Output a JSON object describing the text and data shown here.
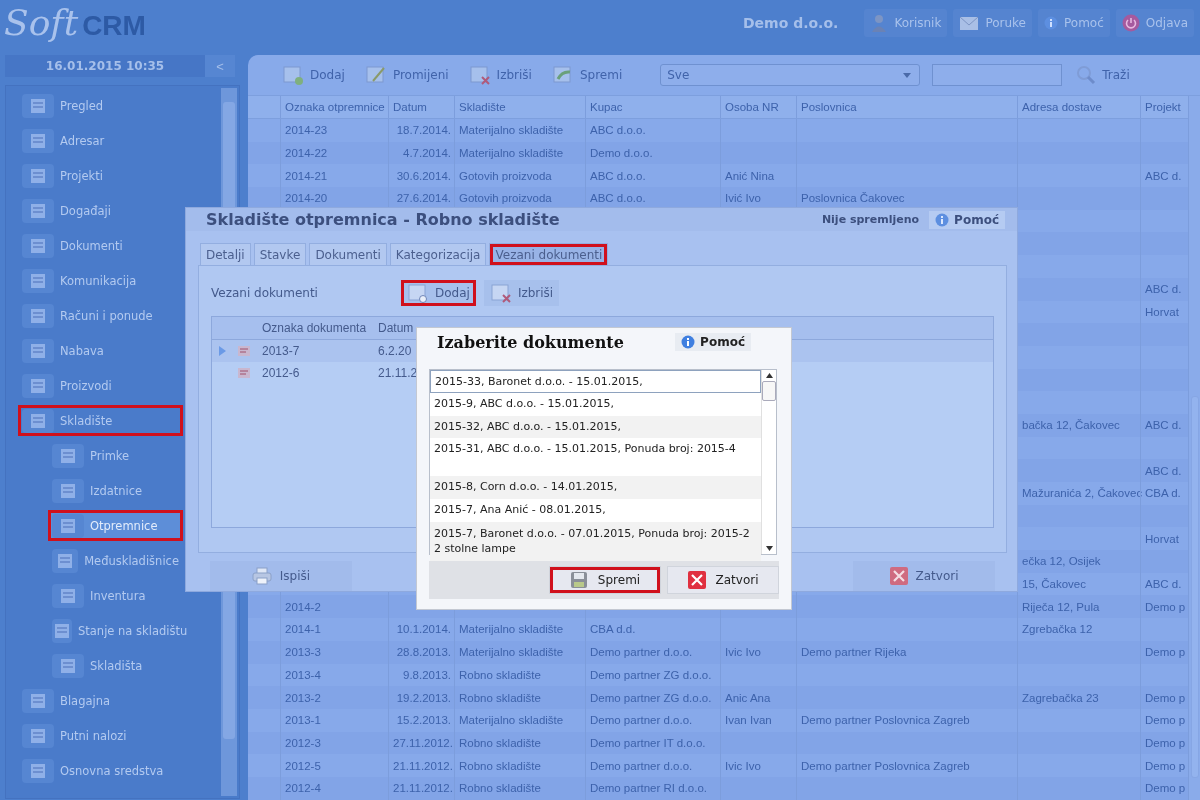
{
  "header": {
    "logo_light": "Soft",
    "logo_bold": "CRM",
    "company": "Demo d.o.o.",
    "buttons": [
      {
        "kind": "user",
        "label": "Korisnik"
      },
      {
        "kind": "mail",
        "label": "Poruke"
      },
      {
        "kind": "info",
        "label": "Pomoć"
      },
      {
        "kind": "power",
        "label": "Odjava"
      }
    ]
  },
  "sidebar": {
    "datetime": "16.01.2015 10:35",
    "collapse": "<",
    "items": [
      {
        "label": "Pregled",
        "highlighted": false,
        "selected": false
      },
      {
        "label": "Adresar",
        "highlighted": false,
        "selected": false
      },
      {
        "label": "Projekti",
        "highlighted": false,
        "selected": false
      },
      {
        "label": "Događaji",
        "highlighted": false,
        "selected": false
      },
      {
        "label": "Dokumenti",
        "highlighted": false,
        "selected": false
      },
      {
        "label": "Komunikacija",
        "highlighted": false,
        "selected": false
      },
      {
        "label": "Računi i ponude",
        "highlighted": false,
        "selected": false
      },
      {
        "label": "Nabava",
        "highlighted": false,
        "selected": false
      },
      {
        "label": "Proizvodi",
        "highlighted": false,
        "selected": false
      },
      {
        "label": "Skladište",
        "highlighted": true,
        "selected": false,
        "children": [
          {
            "label": "Primke",
            "highlighted": false,
            "selected": false
          },
          {
            "label": "Izdatnice",
            "highlighted": false,
            "selected": false
          },
          {
            "label": "Otpremnice",
            "highlighted": true,
            "selected": true
          },
          {
            "label": "Međuskladišnice",
            "highlighted": false,
            "selected": false
          },
          {
            "label": "Inventura",
            "highlighted": false,
            "selected": false
          },
          {
            "label": "Stanje na skladištu",
            "highlighted": false,
            "selected": false
          },
          {
            "label": "Skladišta",
            "highlighted": false,
            "selected": false
          }
        ]
      },
      {
        "label": "Blagajna",
        "highlighted": false,
        "selected": false
      },
      {
        "label": "Putni nalozi",
        "highlighted": false,
        "selected": false
      },
      {
        "label": "Osnovna sredstva",
        "highlighted": false,
        "selected": false
      }
    ]
  },
  "toolbar": {
    "buttons": [
      {
        "kind": "add",
        "label": "Dodaj"
      },
      {
        "kind": "edit",
        "label": "Promijeni"
      },
      {
        "kind": "delete",
        "label": "Izbriši"
      },
      {
        "kind": "export",
        "label": "Spremi"
      }
    ],
    "filter": "Sve",
    "search_button": "Traži"
  },
  "table": {
    "columns": [
      "Oznaka otpremnice",
      "Datum",
      "Skladište",
      "Kupac",
      "Osoba NR",
      "Poslovnica",
      "Adresa dostave",
      "Projekt"
    ],
    "rows": [
      [
        "2014-23",
        "18.7.2014.",
        "Materijalno skladište",
        "ABC d.o.o.",
        null,
        null,
        null,
        null
      ],
      [
        "2014-22",
        "4.7.2014.",
        "Materijalno skladište",
        "Demo d.o.o.",
        null,
        null,
        null,
        null
      ],
      [
        "2014-21",
        "30.6.2014.",
        "Gotovih proizvoda",
        "ABC d.o.o.",
        "Anić Nina",
        null,
        null,
        "ABC d."
      ],
      [
        "2014-20",
        "27.6.2014.",
        "Gotovih proizvoda",
        "ABC d.o.o.",
        "Ivić Ivo",
        "Poslovnica Čakovec",
        null,
        null
      ],
      [
        null,
        null,
        null,
        null,
        null,
        null,
        null,
        null
      ],
      [
        null,
        null,
        null,
        null,
        null,
        null,
        null,
        null
      ],
      [
        null,
        null,
        null,
        null,
        null,
        null,
        null,
        null
      ],
      [
        null,
        null,
        null,
        null,
        null,
        null,
        null,
        "ABC d."
      ],
      [
        null,
        null,
        null,
        null,
        null,
        null,
        null,
        "Horvat"
      ],
      [
        null,
        null,
        null,
        null,
        null,
        null,
        null,
        null
      ],
      [
        null,
        null,
        null,
        null,
        null,
        null,
        null,
        null
      ],
      [
        null,
        null,
        null,
        null,
        null,
        null,
        null,
        null
      ],
      [
        null,
        null,
        null,
        null,
        null,
        null,
        null,
        null
      ],
      [
        null,
        null,
        null,
        null,
        null,
        null,
        "bačka 12, Čakovec",
        "ABC d."
      ],
      [
        null,
        null,
        null,
        null,
        null,
        null,
        null,
        null
      ],
      [
        null,
        null,
        null,
        null,
        null,
        null,
        null,
        "ABC d."
      ],
      [
        null,
        null,
        null,
        null,
        null,
        null,
        "Mažuranića 2, Čakovec",
        "CBA d."
      ],
      [
        null,
        null,
        null,
        null,
        null,
        null,
        null,
        null
      ],
      [
        null,
        null,
        null,
        null,
        null,
        null,
        null,
        "Horvat"
      ],
      [
        null,
        null,
        null,
        null,
        null,
        null,
        "ečka 12, Osijek",
        null
      ],
      [
        null,
        null,
        null,
        null,
        null,
        null,
        "15, Čakovec",
        "ABC d."
      ],
      [
        "2014-2",
        null,
        null,
        null,
        null,
        null,
        "Riječa 12, Pula",
        "Demo p"
      ],
      [
        "2014-1",
        "10.1.2014.",
        "Materijalno skladište",
        "CBA d.d.",
        null,
        null,
        "Zgrebačka 12",
        null
      ],
      [
        "2013-3",
        "28.8.2013.",
        "Materijalno skladište",
        "Demo partner d.o.o.",
        "Ivic Ivo",
        "Demo partner Rijeka",
        null,
        "Demo p"
      ],
      [
        "2013-4",
        "9.8.2013.",
        "Robno skladište",
        "Demo partner ZG d.o.o.",
        null,
        null,
        null,
        null
      ],
      [
        "2013-2",
        "19.2.2013.",
        "Robno skladište",
        "Demo partner ZG d.o.o.",
        "Anic Ana",
        null,
        "Zagrebačka 23",
        "Demo p"
      ],
      [
        "2013-1",
        "15.2.2013.",
        "Materijalno skladište",
        "Demo partner d.o.o.",
        "Ivan Ivan",
        "Demo partner Poslovnica Zagreb",
        null,
        "Demo p"
      ],
      [
        "2012-3",
        "27.11.2012.",
        "Robno skladište",
        "Demo partner IT d.o.o.",
        null,
        null,
        null,
        "Demo p"
      ],
      [
        "2012-5",
        "21.11.2012.",
        "Robno skladište",
        "Demo partner d.o.o.",
        "Ivic Ivo",
        "Demo partner Poslovnica Zagreb",
        null,
        "Demo p"
      ],
      [
        "2012-4",
        "21.11.2012.",
        "Robno skladište",
        "Demo partner RI d.o.o.",
        null,
        null,
        null,
        "Demo p"
      ]
    ]
  },
  "dialog": {
    "title": "Skladište otpremnica - Robno skladište",
    "status": "Nije spremljeno",
    "help": "Pomoć",
    "tabs": [
      {
        "label": "Detalji",
        "selected": false,
        "highlighted": false
      },
      {
        "label": "Stavke",
        "selected": false,
        "highlighted": false
      },
      {
        "label": "Dokumenti",
        "selected": false,
        "highlighted": false
      },
      {
        "label": "Kategorizacija",
        "selected": false,
        "highlighted": false
      },
      {
        "label": "Vezani dokumenti",
        "selected": true,
        "highlighted": true
      }
    ],
    "section_label": "Vezani dokumenti",
    "section_buttons": [
      {
        "kind": "add",
        "label": "Dodaj",
        "highlighted": true
      },
      {
        "kind": "delete",
        "label": "Izbriši",
        "highlighted": false
      }
    ],
    "grid": {
      "columns": [
        "Oznaka dokumenta",
        "Datum"
      ],
      "rows": [
        {
          "oznaka": "2013-7",
          "datum": "6.2.20",
          "selected": true
        },
        {
          "oznaka": "2012-6",
          "datum": "21.11.2",
          "selected": false
        }
      ]
    },
    "print_button": "Ispiši",
    "close_button": "Zatvori"
  },
  "picker": {
    "title": "Izaberite dokumente",
    "help": "Pomoć",
    "items": [
      {
        "text": "2015-33, Baronet d.o.o. - 15.01.2015,",
        "selected": true
      },
      {
        "text": "2015-9, ABC d.o.o. - 15.01.2015,",
        "selected": false
      },
      {
        "text": "2015-32, ABC d.o.o. - 15.01.2015,",
        "selected": false
      },
      {
        "text": "2015-31, ABC d.o.o. - 15.01.2015,  Ponuda broj: 2015-4",
        "selected": false
      },
      {
        "text": "2015-8, Corn d.o.o. - 14.01.2015,",
        "selected": false
      },
      {
        "text": "2015-7, Ana Anić - 08.01.2015,",
        "selected": false
      },
      {
        "text": "2015-7, Baronet d.o.o. - 07.01.2015,  Ponuda broj: 2015-2",
        "note": "2 stolne lampe",
        "selected": false
      }
    ],
    "buttons": [
      {
        "kind": "save",
        "label": "Spremi",
        "highlighted": true
      },
      {
        "kind": "close",
        "label": "Zatvori",
        "highlighted": false
      }
    ]
  }
}
